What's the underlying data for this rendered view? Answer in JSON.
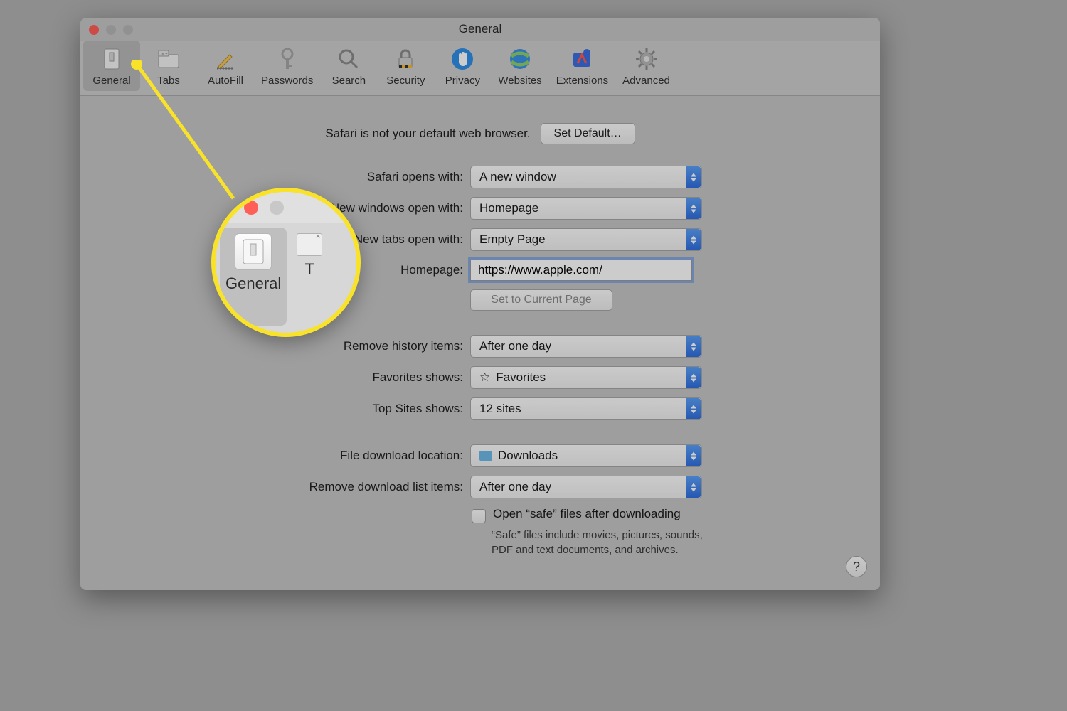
{
  "window": {
    "title": "General"
  },
  "toolbar": {
    "items": [
      {
        "id": "general",
        "label": "General",
        "active": true
      },
      {
        "id": "tabs",
        "label": "Tabs"
      },
      {
        "id": "autofill",
        "label": "AutoFill"
      },
      {
        "id": "passwords",
        "label": "Passwords"
      },
      {
        "id": "search",
        "label": "Search"
      },
      {
        "id": "security",
        "label": "Security"
      },
      {
        "id": "privacy",
        "label": "Privacy"
      },
      {
        "id": "websites",
        "label": "Websites"
      },
      {
        "id": "extensions",
        "label": "Extensions"
      },
      {
        "id": "advanced",
        "label": "Advanced"
      }
    ]
  },
  "banner": {
    "text": "Safari is not your default web browser.",
    "button": "Set Default…"
  },
  "fields": {
    "opens_with": {
      "label": "Safari opens with:",
      "value": "A new window"
    },
    "windows_open_with": {
      "label": "New windows open with:",
      "value": "Homepage"
    },
    "tabs_open_with": {
      "label": "New tabs open with:",
      "value": "Empty Page"
    },
    "homepage": {
      "label": "Homepage:",
      "value": "https://www.apple.com/"
    },
    "set_current": {
      "button": "Set to Current Page"
    },
    "remove_history": {
      "label": "Remove history items:",
      "value": "After one day"
    },
    "favorites_shows": {
      "label": "Favorites shows:",
      "value": "Favorites",
      "icon": "star"
    },
    "top_sites_shows": {
      "label": "Top Sites shows:",
      "value": "12 sites"
    },
    "download_location": {
      "label": "File download location:",
      "value": "Downloads",
      "icon": "folder"
    },
    "remove_downloads": {
      "label": "Remove download list items:",
      "value": "After one day"
    }
  },
  "safe_files": {
    "checkbox_label": "Open “safe” files after downloading",
    "hint": "“Safe” files include movies, pictures, sounds, PDF and text documents, and archives."
  },
  "help_button": "?",
  "magnifier": {
    "label_general": "General",
    "label_tabs_initial": "T"
  }
}
